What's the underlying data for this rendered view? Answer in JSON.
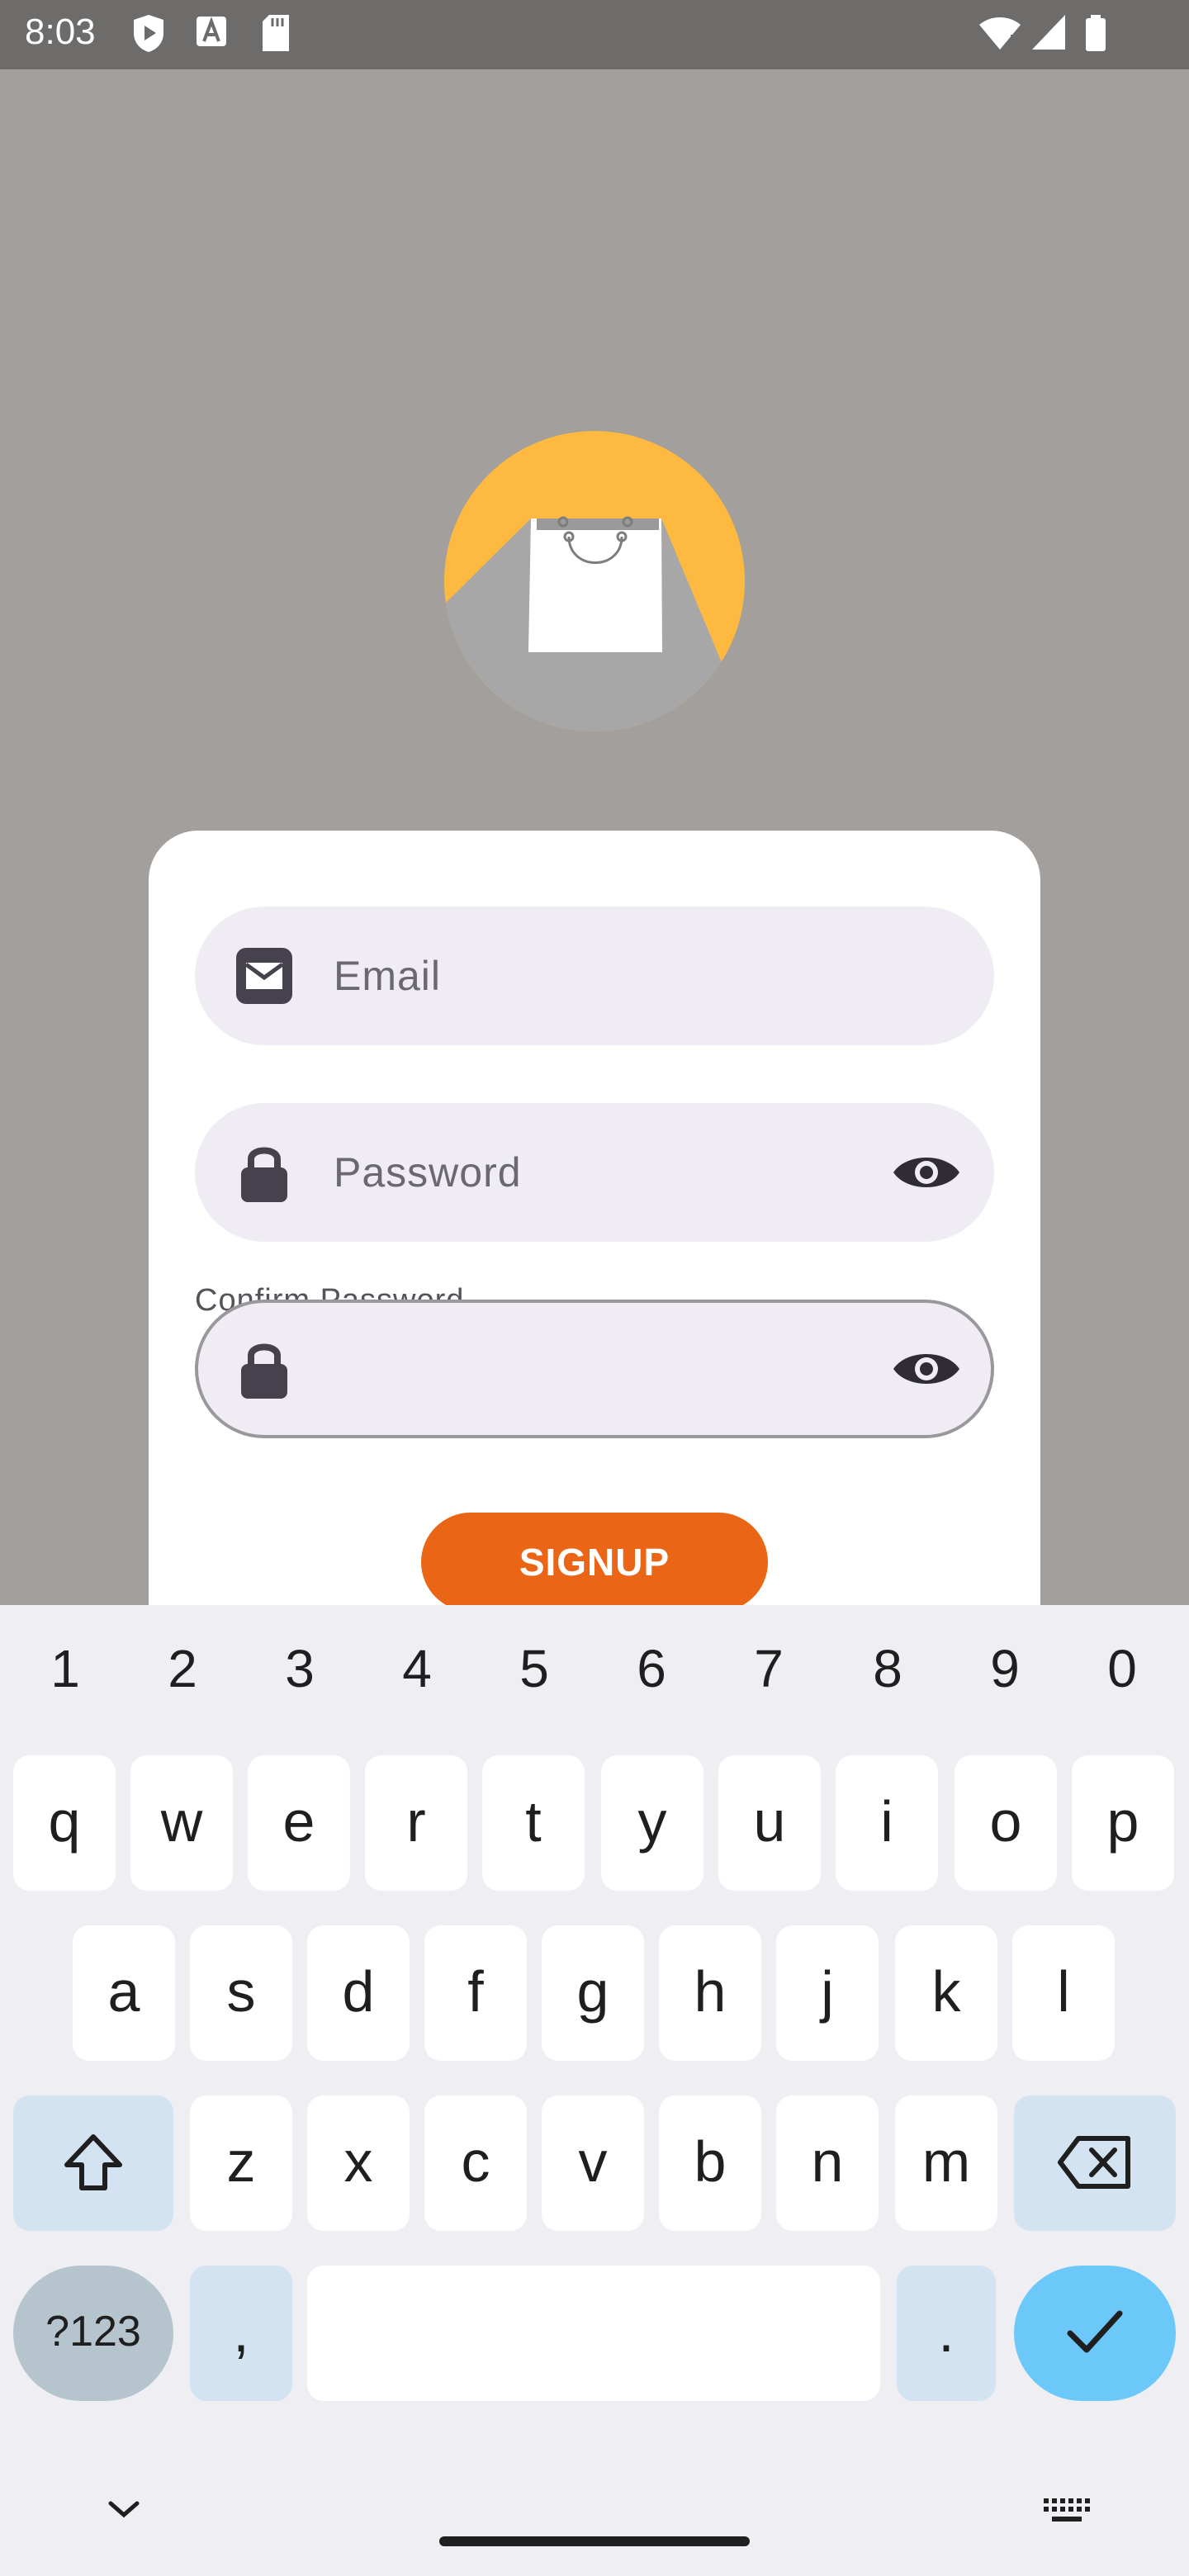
{
  "status_bar": {
    "time": "8:03"
  },
  "form": {
    "email_placeholder": "Email",
    "password_placeholder": "Password",
    "confirm_label": "Confirm Password",
    "confirm_value": "",
    "signup_label": "SIGNUP"
  },
  "keyboard": {
    "numbers": [
      "1",
      "2",
      "3",
      "4",
      "5",
      "6",
      "7",
      "8",
      "9",
      "0"
    ],
    "row1": [
      "q",
      "w",
      "e",
      "r",
      "t",
      "y",
      "u",
      "i",
      "o",
      "p"
    ],
    "row2": [
      "a",
      "s",
      "d",
      "f",
      "g",
      "h",
      "j",
      "k",
      "l"
    ],
    "row3": [
      "z",
      "x",
      "c",
      "v",
      "b",
      "n",
      "m"
    ],
    "symbols_label": "?123",
    "comma": ",",
    "period": "."
  },
  "colors": {
    "accent": "#ea6515",
    "logo": "#fdb940",
    "backdrop": "#a29f9c"
  }
}
